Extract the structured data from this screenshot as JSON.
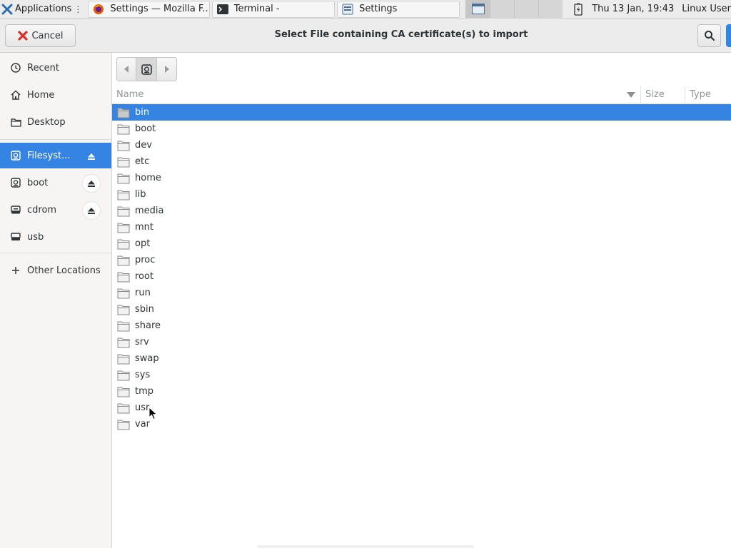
{
  "taskbar": {
    "applications_label": "Applications",
    "applications_sep": "⋮",
    "tasks": [
      {
        "label": "Settings — Mozilla F...",
        "icon": "firefox-icon"
      },
      {
        "label": "Terminal -",
        "icon": "terminal-icon"
      },
      {
        "label": "Settings",
        "icon": "settings-icon"
      }
    ],
    "workspaces": 4,
    "active_workspace": 1,
    "clock": "Thu 13 Jan, 19:43",
    "user": "Linux User"
  },
  "dialog": {
    "title": "Select File containing CA certificate(s) to import",
    "cancel_label": "Cancel",
    "search_icon": "search-icon",
    "accent_color": "#3584e4"
  },
  "sidebar": {
    "items": [
      {
        "label": "Recent",
        "icon": "clock-icon"
      },
      {
        "label": "Home",
        "icon": "home-icon"
      },
      {
        "label": "Desktop",
        "icon": "folder-icon"
      },
      {
        "label": "Filesyst...",
        "icon": "drive-icon",
        "selected": true,
        "eject": true
      },
      {
        "label": "boot",
        "icon": "drive-icon",
        "eject": true
      },
      {
        "label": "cdrom",
        "icon": "optical-drive-icon",
        "eject": true
      },
      {
        "label": "usb",
        "icon": "usb-drive-icon"
      },
      {
        "label": "Other Locations",
        "icon": "plus-icon"
      }
    ]
  },
  "filelist": {
    "columns": {
      "name": "Name",
      "size": "Size",
      "type": "Type"
    },
    "selected": "bin",
    "rows": [
      "bin",
      "boot",
      "dev",
      "etc",
      "home",
      "lib",
      "media",
      "mnt",
      "opt",
      "proc",
      "root",
      "run",
      "sbin",
      "share",
      "srv",
      "swap",
      "sys",
      "tmp",
      "usr",
      "var"
    ]
  }
}
